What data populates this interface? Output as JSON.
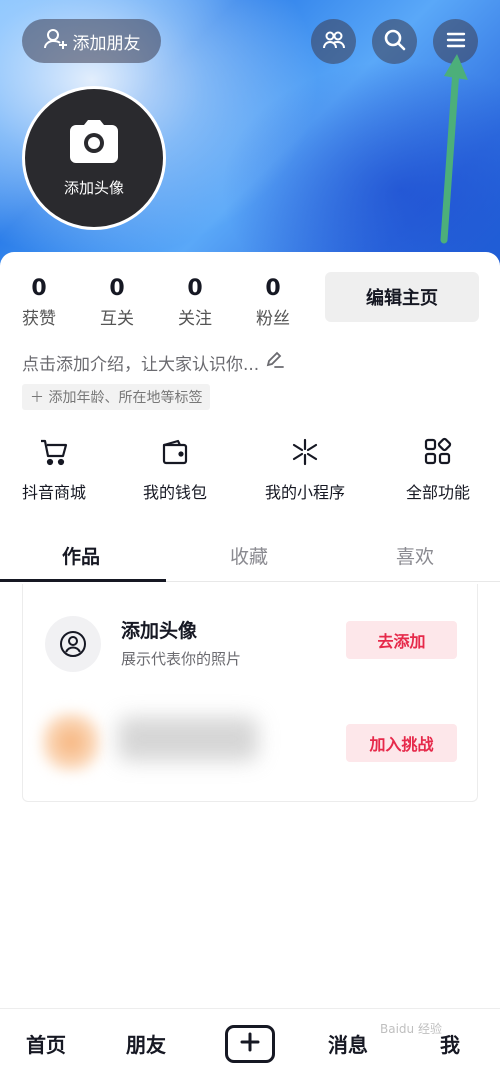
{
  "header": {
    "add_friend_label": "添加朋友",
    "avatar_label": "添加头像"
  },
  "stats": [
    {
      "value": "0",
      "label": "获赞"
    },
    {
      "value": "0",
      "label": "互关"
    },
    {
      "value": "0",
      "label": "关注"
    },
    {
      "value": "0",
      "label": "粉丝"
    }
  ],
  "profile": {
    "edit_label": "编辑主页",
    "intro_placeholder": "点击添加介绍，让大家认识你...",
    "tag_label": "＋ 添加年龄、所在地等标签"
  },
  "quick_actions": [
    {
      "label": "抖音商城",
      "icon": "cart-icon"
    },
    {
      "label": "我的钱包",
      "icon": "wallet-icon"
    },
    {
      "label": "我的小程序",
      "icon": "mini-program-icon"
    },
    {
      "label": "全部功能",
      "icon": "grid-icon"
    }
  ],
  "tabs": [
    {
      "label": "作品",
      "active": true
    },
    {
      "label": "收藏",
      "active": false
    },
    {
      "label": "喜欢",
      "active": false
    }
  ],
  "tasks": {
    "avatar_title": "添加头像",
    "avatar_subtitle": "展示代表你的照片",
    "avatar_button": "去添加",
    "challenge_button": "加入挑战"
  },
  "bottom_nav": {
    "home": "首页",
    "friends": "朋友",
    "messages": "消息",
    "me": "我"
  },
  "watermark": "Baidu 经验",
  "colors": {
    "accent_red": "#e6294a",
    "pill_bg": "#fde7ea",
    "arrow_green": "#3cb371",
    "header_blue": "#2b7de9"
  }
}
